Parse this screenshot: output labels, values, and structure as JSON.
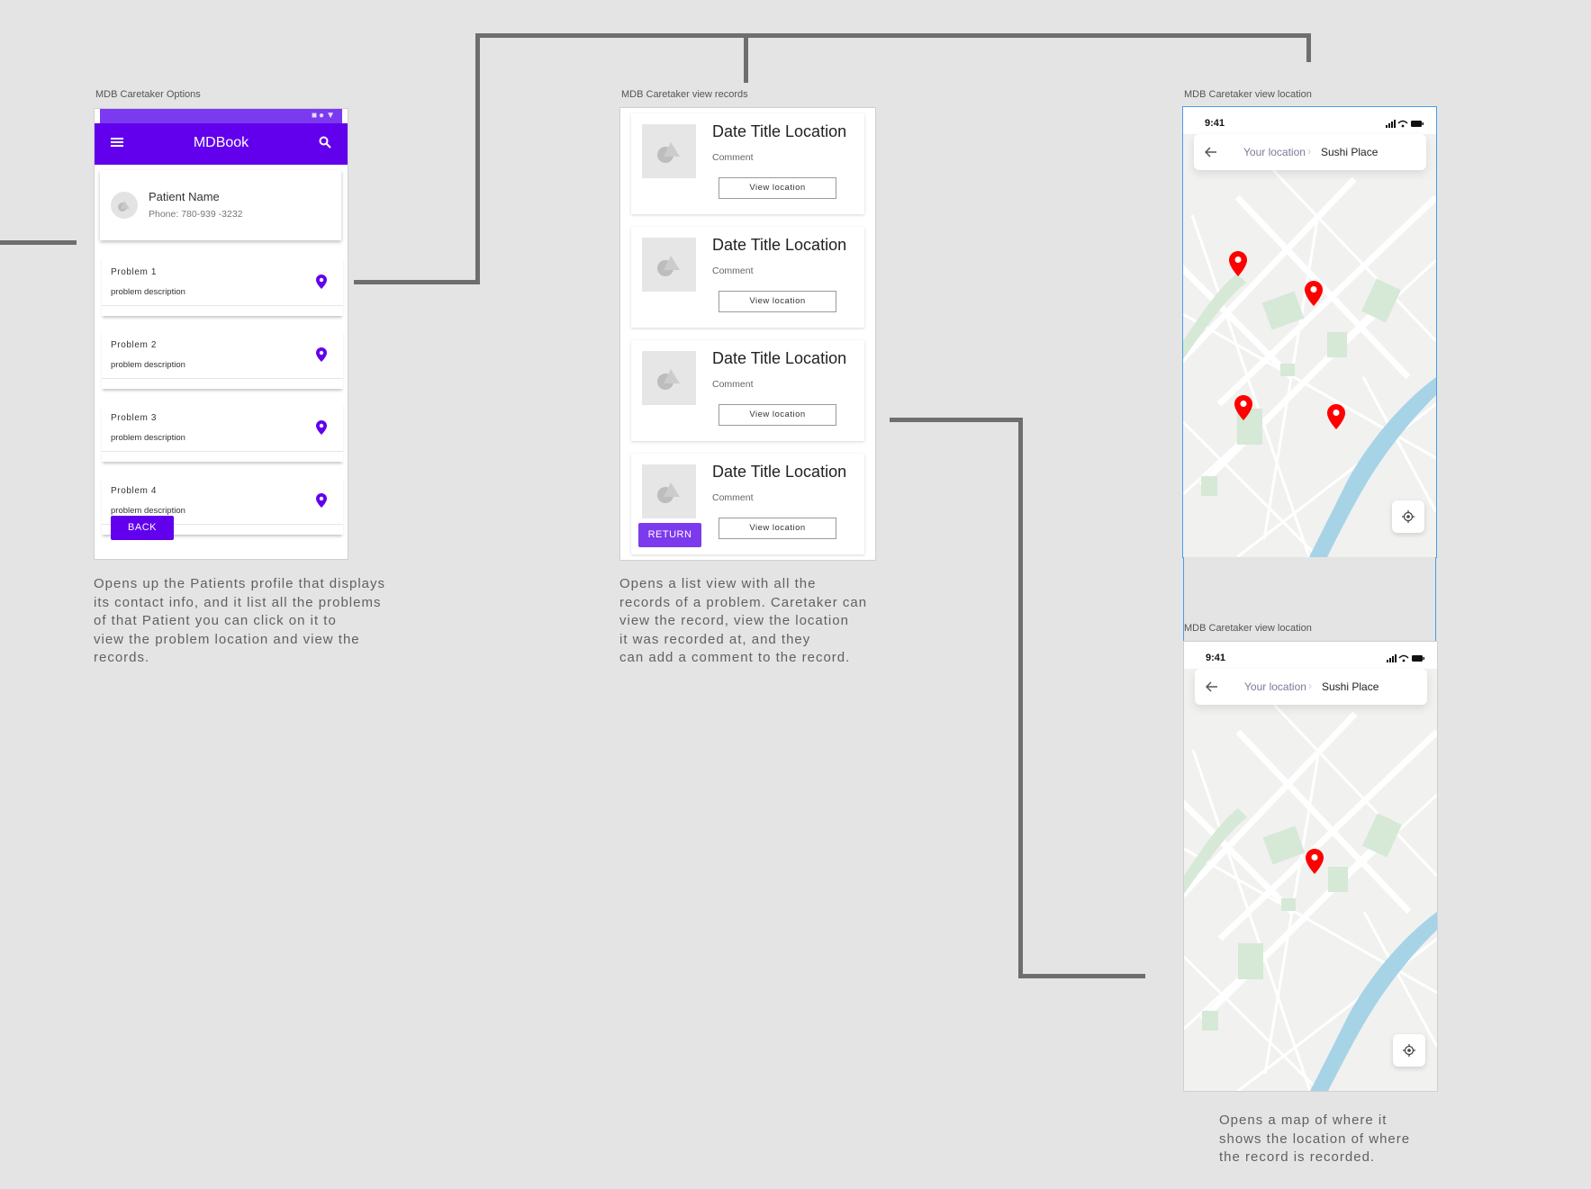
{
  "screens": {
    "options": {
      "frame_label": "MDB Caretaker Options",
      "app_title": "MDBook",
      "patient": {
        "name": "Patient Name",
        "phone": "Phone: 780-939 -3232"
      },
      "problems": [
        {
          "name": "Problem 1",
          "description": "problem description"
        },
        {
          "name": "Problem 2",
          "description": "problem description"
        },
        {
          "name": "Problem 3",
          "description": "problem description"
        },
        {
          "name": "Problem 4",
          "description": "problem description"
        }
      ],
      "back_label": "BACK",
      "description": "Opens up the Patients profile that displays\nits contact info, and it list all the problems\nof that Patient you can click on it to\nview the problem location and view the\nrecords."
    },
    "records": {
      "frame_label": "MDB Caretaker view records",
      "items": [
        {
          "title": "Date Title Location",
          "comment": "Comment",
          "button": "View location"
        },
        {
          "title": "Date Title Location",
          "comment": "Comment",
          "button": "View location"
        },
        {
          "title": "Date Title Location",
          "comment": "Comment",
          "button": "View location"
        },
        {
          "title": "Date Title Location",
          "comment": "Comment",
          "button": "View location"
        }
      ],
      "return_label": "RETURN",
      "description": "Opens a list view with all the\nrecords of a problem. Caretaker can\nview the record, view the location\nit was recorded at, and they\ncan add a comment to the record."
    },
    "location_all": {
      "frame_label": "MDB Caretaker view location",
      "time": "9:41",
      "crumb_from": "Your location",
      "crumb_to": "Sushi Place"
    },
    "location_single": {
      "frame_label": "MDB Caretaker view location",
      "time": "9:41",
      "crumb_from": "Your location",
      "crumb_to": "Sushi Place",
      "description": "Opens a map of where it\nshows the location of where\nthe record is recorded."
    }
  },
  "colors": {
    "primary": "#6200ee",
    "return_button": "#7c3aed",
    "marker": "#ff0000",
    "canvas": "#e4e4e4",
    "connector": "#6e6e6e"
  },
  "icons": [
    "menu-icon",
    "search-icon",
    "location-pin-icon",
    "back-arrow-icon",
    "locate-icon",
    "image-placeholder-icon",
    "avatar-placeholder-icon"
  ]
}
